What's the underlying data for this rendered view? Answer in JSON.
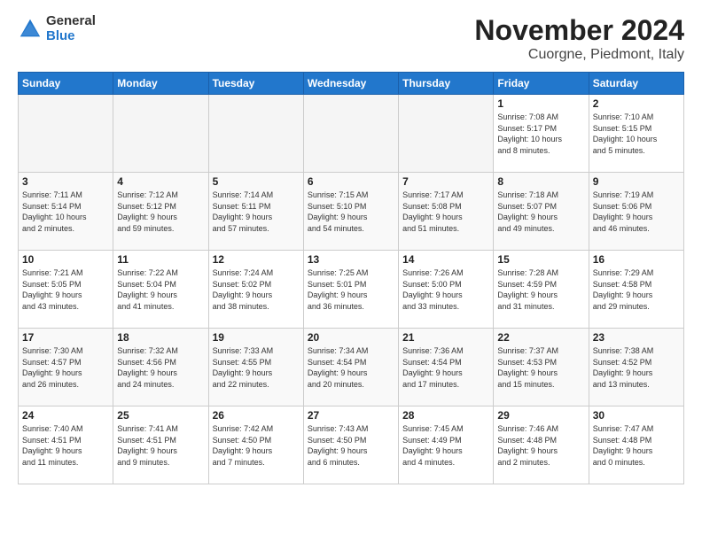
{
  "header": {
    "logo_line1": "General",
    "logo_line2": "Blue",
    "title": "November 2024",
    "subtitle": "Cuorgne, Piedmont, Italy"
  },
  "days_of_week": [
    "Sunday",
    "Monday",
    "Tuesday",
    "Wednesday",
    "Thursday",
    "Friday",
    "Saturday"
  ],
  "weeks": [
    [
      {
        "day": "",
        "info": ""
      },
      {
        "day": "",
        "info": ""
      },
      {
        "day": "",
        "info": ""
      },
      {
        "day": "",
        "info": ""
      },
      {
        "day": "",
        "info": ""
      },
      {
        "day": "1",
        "info": "Sunrise: 7:08 AM\nSunset: 5:17 PM\nDaylight: 10 hours\nand 8 minutes."
      },
      {
        "day": "2",
        "info": "Sunrise: 7:10 AM\nSunset: 5:15 PM\nDaylight: 10 hours\nand 5 minutes."
      }
    ],
    [
      {
        "day": "3",
        "info": "Sunrise: 7:11 AM\nSunset: 5:14 PM\nDaylight: 10 hours\nand 2 minutes."
      },
      {
        "day": "4",
        "info": "Sunrise: 7:12 AM\nSunset: 5:12 PM\nDaylight: 9 hours\nand 59 minutes."
      },
      {
        "day": "5",
        "info": "Sunrise: 7:14 AM\nSunset: 5:11 PM\nDaylight: 9 hours\nand 57 minutes."
      },
      {
        "day": "6",
        "info": "Sunrise: 7:15 AM\nSunset: 5:10 PM\nDaylight: 9 hours\nand 54 minutes."
      },
      {
        "day": "7",
        "info": "Sunrise: 7:17 AM\nSunset: 5:08 PM\nDaylight: 9 hours\nand 51 minutes."
      },
      {
        "day": "8",
        "info": "Sunrise: 7:18 AM\nSunset: 5:07 PM\nDaylight: 9 hours\nand 49 minutes."
      },
      {
        "day": "9",
        "info": "Sunrise: 7:19 AM\nSunset: 5:06 PM\nDaylight: 9 hours\nand 46 minutes."
      }
    ],
    [
      {
        "day": "10",
        "info": "Sunrise: 7:21 AM\nSunset: 5:05 PM\nDaylight: 9 hours\nand 43 minutes."
      },
      {
        "day": "11",
        "info": "Sunrise: 7:22 AM\nSunset: 5:04 PM\nDaylight: 9 hours\nand 41 minutes."
      },
      {
        "day": "12",
        "info": "Sunrise: 7:24 AM\nSunset: 5:02 PM\nDaylight: 9 hours\nand 38 minutes."
      },
      {
        "day": "13",
        "info": "Sunrise: 7:25 AM\nSunset: 5:01 PM\nDaylight: 9 hours\nand 36 minutes."
      },
      {
        "day": "14",
        "info": "Sunrise: 7:26 AM\nSunset: 5:00 PM\nDaylight: 9 hours\nand 33 minutes."
      },
      {
        "day": "15",
        "info": "Sunrise: 7:28 AM\nSunset: 4:59 PM\nDaylight: 9 hours\nand 31 minutes."
      },
      {
        "day": "16",
        "info": "Sunrise: 7:29 AM\nSunset: 4:58 PM\nDaylight: 9 hours\nand 29 minutes."
      }
    ],
    [
      {
        "day": "17",
        "info": "Sunrise: 7:30 AM\nSunset: 4:57 PM\nDaylight: 9 hours\nand 26 minutes."
      },
      {
        "day": "18",
        "info": "Sunrise: 7:32 AM\nSunset: 4:56 PM\nDaylight: 9 hours\nand 24 minutes."
      },
      {
        "day": "19",
        "info": "Sunrise: 7:33 AM\nSunset: 4:55 PM\nDaylight: 9 hours\nand 22 minutes."
      },
      {
        "day": "20",
        "info": "Sunrise: 7:34 AM\nSunset: 4:54 PM\nDaylight: 9 hours\nand 20 minutes."
      },
      {
        "day": "21",
        "info": "Sunrise: 7:36 AM\nSunset: 4:54 PM\nDaylight: 9 hours\nand 17 minutes."
      },
      {
        "day": "22",
        "info": "Sunrise: 7:37 AM\nSunset: 4:53 PM\nDaylight: 9 hours\nand 15 minutes."
      },
      {
        "day": "23",
        "info": "Sunrise: 7:38 AM\nSunset: 4:52 PM\nDaylight: 9 hours\nand 13 minutes."
      }
    ],
    [
      {
        "day": "24",
        "info": "Sunrise: 7:40 AM\nSunset: 4:51 PM\nDaylight: 9 hours\nand 11 minutes."
      },
      {
        "day": "25",
        "info": "Sunrise: 7:41 AM\nSunset: 4:51 PM\nDaylight: 9 hours\nand 9 minutes."
      },
      {
        "day": "26",
        "info": "Sunrise: 7:42 AM\nSunset: 4:50 PM\nDaylight: 9 hours\nand 7 minutes."
      },
      {
        "day": "27",
        "info": "Sunrise: 7:43 AM\nSunset: 4:50 PM\nDaylight: 9 hours\nand 6 minutes."
      },
      {
        "day": "28",
        "info": "Sunrise: 7:45 AM\nSunset: 4:49 PM\nDaylight: 9 hours\nand 4 minutes."
      },
      {
        "day": "29",
        "info": "Sunrise: 7:46 AM\nSunset: 4:48 PM\nDaylight: 9 hours\nand 2 minutes."
      },
      {
        "day": "30",
        "info": "Sunrise: 7:47 AM\nSunset: 4:48 PM\nDaylight: 9 hours\nand 0 minutes."
      }
    ]
  ]
}
